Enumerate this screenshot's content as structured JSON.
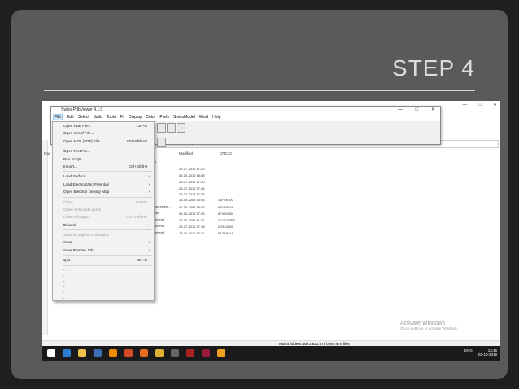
{
  "slide": {
    "title": "STEP 4"
  },
  "pdb_window": {
    "title": "Swiss-PdbViewer 4.1.0",
    "controls": [
      "—",
      "□",
      "✕"
    ],
    "menus": [
      "File",
      "Edit",
      "Select",
      "Build",
      "Tools",
      "Fit",
      "Display",
      "Color",
      "Prefs",
      "SwissModel",
      "Wind",
      "Help"
    ]
  },
  "file_menu": {
    "items": [
      {
        "label": "Open PDB File...",
        "shortcut": "Ctrl+O",
        "disabled": false
      },
      {
        "label": "Open mmcif File...",
        "shortcut": "",
        "disabled": false
      },
      {
        "label": "Open MOL (SDF) File...",
        "shortcut": "Ctrl+Shift+O",
        "disabled": false
      },
      {
        "sep": true
      },
      {
        "label": "Open Text File...",
        "shortcut": "",
        "disabled": false
      },
      {
        "label": "Run Script...",
        "shortcut": "",
        "disabled": false
      },
      {
        "label": "Import...",
        "shortcut": "Ctrl+Shift+I",
        "disabled": false
      },
      {
        "sep": true
      },
      {
        "label": "Load Surface",
        "shortcut": "",
        "submenu": true,
        "disabled": false
      },
      {
        "label": "Load Electrostatic Potential",
        "shortcut": "",
        "submenu": true,
        "disabled": false
      },
      {
        "label": "Open Electron Density Map",
        "shortcut": "",
        "submenu": true,
        "disabled": false
      },
      {
        "sep": true
      },
      {
        "label": "Close",
        "shortcut": "Ctrl+W",
        "disabled": true
      },
      {
        "label": "Close Selected Layers",
        "shortcut": "",
        "disabled": true
      },
      {
        "label": "Close All Layers",
        "shortcut": "Ctrl+Shift+W",
        "disabled": true
      },
      {
        "label": "Discard",
        "shortcut": "",
        "submenu": true,
        "disabled": false
      },
      {
        "sep": true
      },
      {
        "label": "Save in Original Orientation",
        "shortcut": "",
        "disabled": true
      },
      {
        "label": "Save",
        "shortcut": "",
        "submenu": true,
        "disabled": false
      },
      {
        "label": "Save Remote Job",
        "shortcut": "",
        "submenu": true,
        "disabled": false
      },
      {
        "sep": true
      },
      {
        "label": "Quit",
        "shortcut": "Ctrl+Q",
        "disabled": false
      },
      {
        "sep": true
      },
      {
        "label": "-",
        "dot": true
      },
      {
        "label": "-",
        "dot": true
      },
      {
        "label": "-",
        "dot": true
      },
      {
        "label": "-",
        "dot": true
      },
      {
        "label": "-",
        "dot": true
      },
      {
        "label": "-",
        "dot": true
      }
    ]
  },
  "explorer": {
    "address_text": "unpacked size 48,479,674 bytes",
    "columns": {
      "name": "Nar",
      "modified": "Modified",
      "crc": "CRC32"
    },
    "rows": [
      {
        "name": "e",
        "modified": "",
        "crc": ""
      },
      {
        "name": "r",
        "modified": "25-07-2012 17:20",
        "crc": ""
      },
      {
        "name": "r",
        "modified": "09-10-2012 15:58",
        "crc": ""
      },
      {
        "name": "r",
        "modified": "25-07-2012 17:20",
        "crc": ""
      },
      {
        "name": "r",
        "modified": "25-07-2012 17:24",
        "crc": ""
      },
      {
        "name": "r",
        "modified": "25-07-2012 17:24",
        "crc": ""
      },
      {
        "name": "",
        "modified": "16-05-2008 13:04",
        "crc": "15F93C0C"
      },
      {
        "name": "ion exten...",
        "modified": "02-05-2008 15:03",
        "crc": "8B1B36A5"
      },
      {
        "name": "ion",
        "modified": "09-10-2012 17:06",
        "crc": "8F409360"
      },
      {
        "name": "ument",
        "modified": "20-05-2008 11:26",
        "crc": "CC4D7BEF"
      },
      {
        "name": "ument",
        "modified": "25-07-2012 17:18",
        "crc": "D2943299"
      },
      {
        "name": "ument",
        "modified": "13-04-2011 12:16",
        "crc": "E13D8818"
      }
    ],
    "status": "Total 5 folders and 2,621,978 bytes in 6 files",
    "watermark_line1": "Activate Windows",
    "watermark_line2": "Go to Settings to activate Windows."
  },
  "taskbar": {
    "lang": "ENG",
    "time": "13:46",
    "date": "02-10-2019",
    "icons": [
      "windows-start-icon",
      "edge-icon",
      "explorer-icon",
      "store-icon",
      "vlc-icon",
      "office-icon",
      "firefox-icon",
      "chrome-icon",
      "app-icon",
      "pdbviewer-icon",
      "winrar-icon",
      "app2-icon"
    ],
    "icon_colors": [
      "#ffffff",
      "#2d7fd3",
      "#f0c14b",
      "#3d6fb6",
      "#f08a00",
      "#d34a24",
      "#e86a1e",
      "#e0b030",
      "#666666",
      "#aa2222",
      "#9b1b3a",
      "#f0a020"
    ]
  }
}
